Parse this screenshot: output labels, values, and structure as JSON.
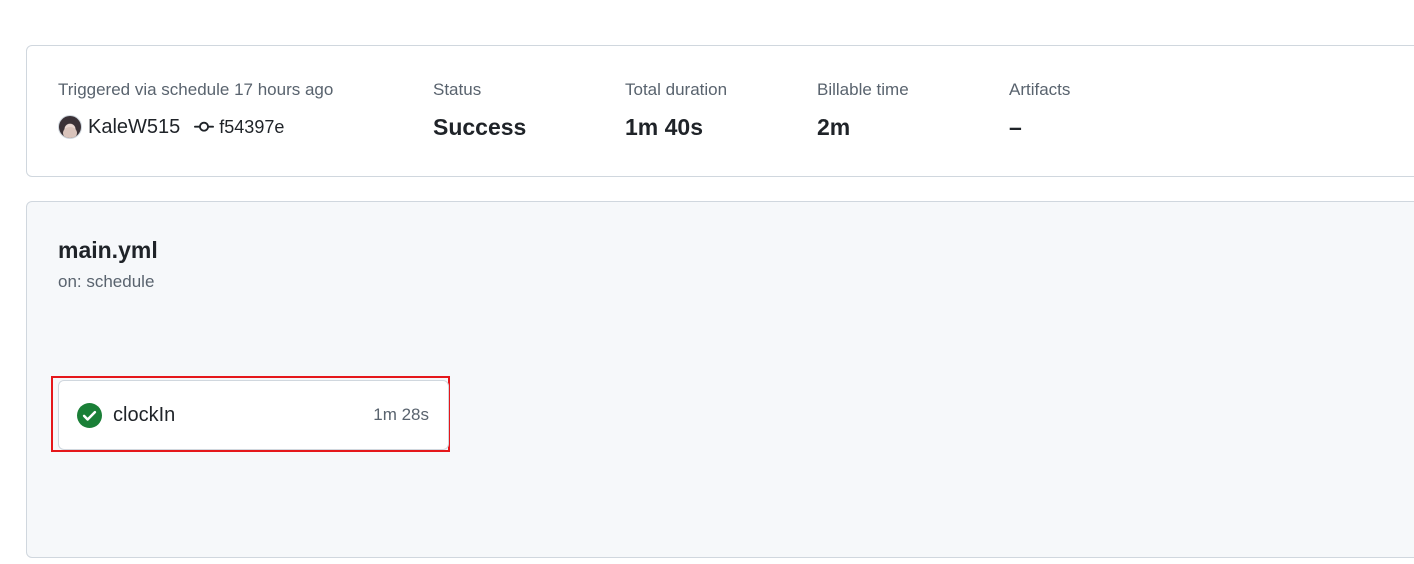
{
  "summary": {
    "trigger_label": "Triggered via schedule 17 hours ago",
    "actor": "KaleW515",
    "commit_sha": "f54397e",
    "status_label": "Status",
    "status_value": "Success",
    "duration_label": "Total duration",
    "duration_value": "1m 40s",
    "billable_label": "Billable time",
    "billable_value": "2m",
    "artifacts_label": "Artifacts",
    "artifacts_value": "–"
  },
  "workflow": {
    "file_name": "main.yml",
    "trigger": "on: schedule",
    "jobs": [
      {
        "name": "clockIn",
        "duration": "1m 28s",
        "status": "success",
        "icon": "check-circle-icon"
      }
    ]
  },
  "colors": {
    "success": "#1a7f37",
    "highlight": "#e5171b",
    "border": "#d0d7de",
    "panel_bg": "#f6f8fa",
    "muted_text": "#59636e"
  }
}
